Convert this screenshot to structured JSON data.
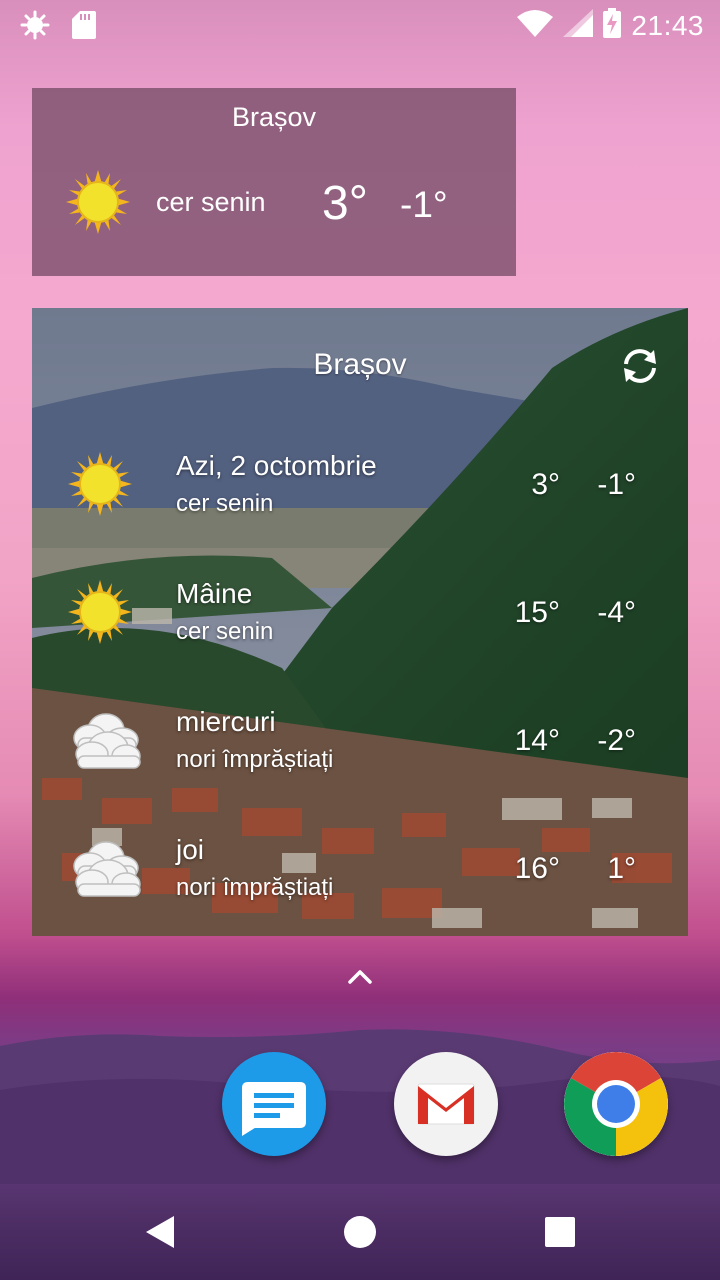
{
  "status_bar": {
    "time": "21:43",
    "icons": [
      "debug-icon",
      "sd-card-icon",
      "wifi-icon",
      "cell-signal-icon",
      "battery-charging-icon"
    ]
  },
  "small_widget": {
    "city": "Brașov",
    "condition": "cer senin",
    "temp_high": "3°",
    "temp_low": "-1°",
    "icon": "sun-icon"
  },
  "large_widget": {
    "city": "Brașov",
    "refresh_icon": "refresh-icon",
    "days": [
      {
        "day": "Azi, 2 octombrie",
        "condition": "cer senin",
        "high": "3°",
        "low": "-1°",
        "icon": "sun-icon"
      },
      {
        "day": "Mâine",
        "condition": "cer senin",
        "high": "15°",
        "low": "-4°",
        "icon": "sun-icon"
      },
      {
        "day": "miercuri",
        "condition": "nori împrăștiați",
        "high": "14°",
        "low": "-2°",
        "icon": "cloud-icon"
      },
      {
        "day": "joi",
        "condition": "nori împrăștiați",
        "high": "16°",
        "low": "1°",
        "icon": "cloud-icon"
      }
    ]
  },
  "dock": {
    "apps": [
      "messages-icon",
      "gmail-icon",
      "chrome-icon"
    ]
  },
  "navigation": {
    "buttons": [
      "back-icon",
      "home-icon",
      "recents-icon"
    ]
  },
  "colors": {
    "sun": "#f2e22c",
    "sun_rays": "#f5b51c",
    "messages_blue": "#1d9be8",
    "gmail_red": "#d93025",
    "chrome_blue": "#3f7ee8"
  }
}
